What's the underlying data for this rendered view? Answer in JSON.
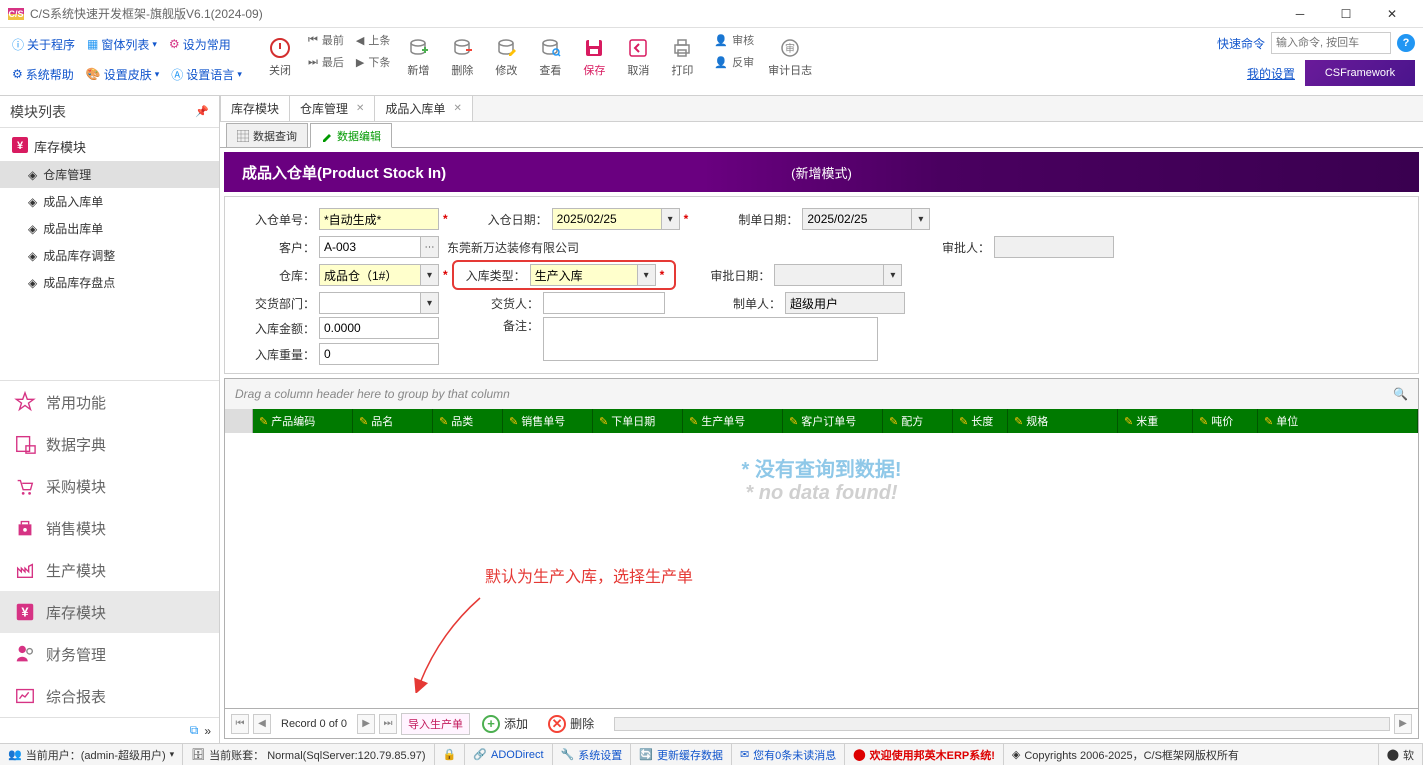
{
  "window": {
    "title": "C/S系统快速开发框架-旗舰版V6.1(2024-09)"
  },
  "topLinks": {
    "row1": [
      {
        "label": "关于程序"
      },
      {
        "label": "窗体列表",
        "hasCaret": true
      },
      {
        "label": "设为常用"
      }
    ],
    "row2": [
      {
        "label": "系统帮助"
      },
      {
        "label": "设置皮肤",
        "hasCaret": true
      },
      {
        "label": "设置语言",
        "hasCaret": true
      }
    ]
  },
  "toolbar": {
    "close": "关闭",
    "navGroup": [
      "最前",
      "上条",
      "最后",
      "下条"
    ],
    "main": [
      "新增",
      "删除",
      "修改",
      "查看",
      "保存",
      "取消",
      "打印"
    ],
    "approvalGroup": [
      "审核",
      "反审",
      "审计日志"
    ]
  },
  "quick": {
    "label": "快速命令",
    "placeholder": "输入命令, 按回车",
    "settings": "我的设置",
    "badge": "CSFramework"
  },
  "sidebar": {
    "title": "模块列表",
    "tree": {
      "root": "库存模块",
      "children": [
        "仓库管理",
        "成品入库单",
        "成品出库单",
        "成品库存调整",
        "成品库存盘点"
      ]
    },
    "modules": [
      "常用功能",
      "数据字典",
      "采购模块",
      "销售模块",
      "生产模块",
      "库存模块",
      "财务管理",
      "综合报表"
    ]
  },
  "tabs": [
    "库存模块",
    "仓库管理",
    "成品入库单"
  ],
  "subTabs": [
    "数据查询",
    "数据编辑"
  ],
  "formHeader": {
    "title": "成品入仓单(Product Stock In)",
    "mode": "(新增模式)"
  },
  "form": {
    "docNo": {
      "label": "入仓单号：",
      "value": "*自动生成*"
    },
    "inDate": {
      "label": "入仓日期：",
      "value": "2025/02/25"
    },
    "docDate": {
      "label": "制单日期：",
      "value": "2025/02/25"
    },
    "customer": {
      "label": "客户：",
      "value": "A-003",
      "display": "东莞新万达装修有限公司"
    },
    "approver": {
      "label": "审批人：",
      "value": ""
    },
    "warehouse": {
      "label": "仓库：",
      "value": "成品仓（1#）"
    },
    "inType": {
      "label": "入库类型：",
      "value": "生产入库"
    },
    "approvalDate": {
      "label": "审批日期：",
      "value": ""
    },
    "dept": {
      "label": "交货部门：",
      "value": ""
    },
    "deliverer": {
      "label": "交货人：",
      "value": ""
    },
    "creator": {
      "label": "制单人：",
      "value": "超级用户"
    },
    "amount": {
      "label": "入库金额：",
      "value": "0.0000"
    },
    "remark": {
      "label": "备注：",
      "value": ""
    },
    "weight": {
      "label": "入库重量：",
      "value": "0"
    }
  },
  "grid": {
    "groupPanel": "Drag a column header here to group by that column",
    "columns": [
      "产品编码",
      "品名",
      "品类",
      "销售单号",
      "下单日期",
      "生产单号",
      "客户订单号",
      "配方",
      "长度",
      "规格",
      "米重",
      "吨价",
      "单位"
    ],
    "noDataCn": "* 没有查询到数据!",
    "noDataEn": "* no data found!",
    "annotation": "默认为生产入库，选择生产单"
  },
  "gridFooter": {
    "record": "Record 0 of 0",
    "import": "导入生产单",
    "add": "添加",
    "delete": "删除"
  },
  "statusbar": {
    "user": "当前用户：(admin-超级用户)",
    "account": "当前账套： Normal(SqlServer:120.79.85.97)",
    "ado": "ADODirect",
    "sysSettings": "系统设置",
    "refreshCache": "更新缓存数据",
    "unread": "您有0条未读消息",
    "welcome": "欢迎使用邦英木ERP系统!",
    "copyright": "Copyrights 2006-2025，C/S框架网版权所有",
    "soft": "软"
  }
}
